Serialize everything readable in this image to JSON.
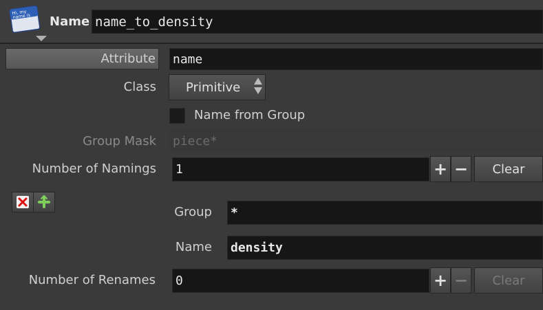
{
  "header": {
    "logo_line1": "Hi, my",
    "logo_line2": "name is",
    "name_label": "Name",
    "name_value": "name_to_density"
  },
  "params": {
    "attribute_label": "Attribute",
    "attribute_value": "name",
    "class_label": "Class",
    "class_value": "Primitive",
    "name_from_group_label": "Name from Group",
    "name_from_group_checked": false,
    "group_mask_label": "Group Mask",
    "group_mask_placeholder": "piece*",
    "namings_label": "Number of Namings",
    "namings_value": "1",
    "clear_label": "Clear"
  },
  "multiparm": {
    "group_label": "Group",
    "group_value": "*",
    "name_label": "Name",
    "name_value": "density"
  },
  "renames": {
    "label": "Number of Renames",
    "value": "0",
    "clear_label": "Clear"
  },
  "icons": {
    "plus": "+",
    "minus": "−"
  }
}
